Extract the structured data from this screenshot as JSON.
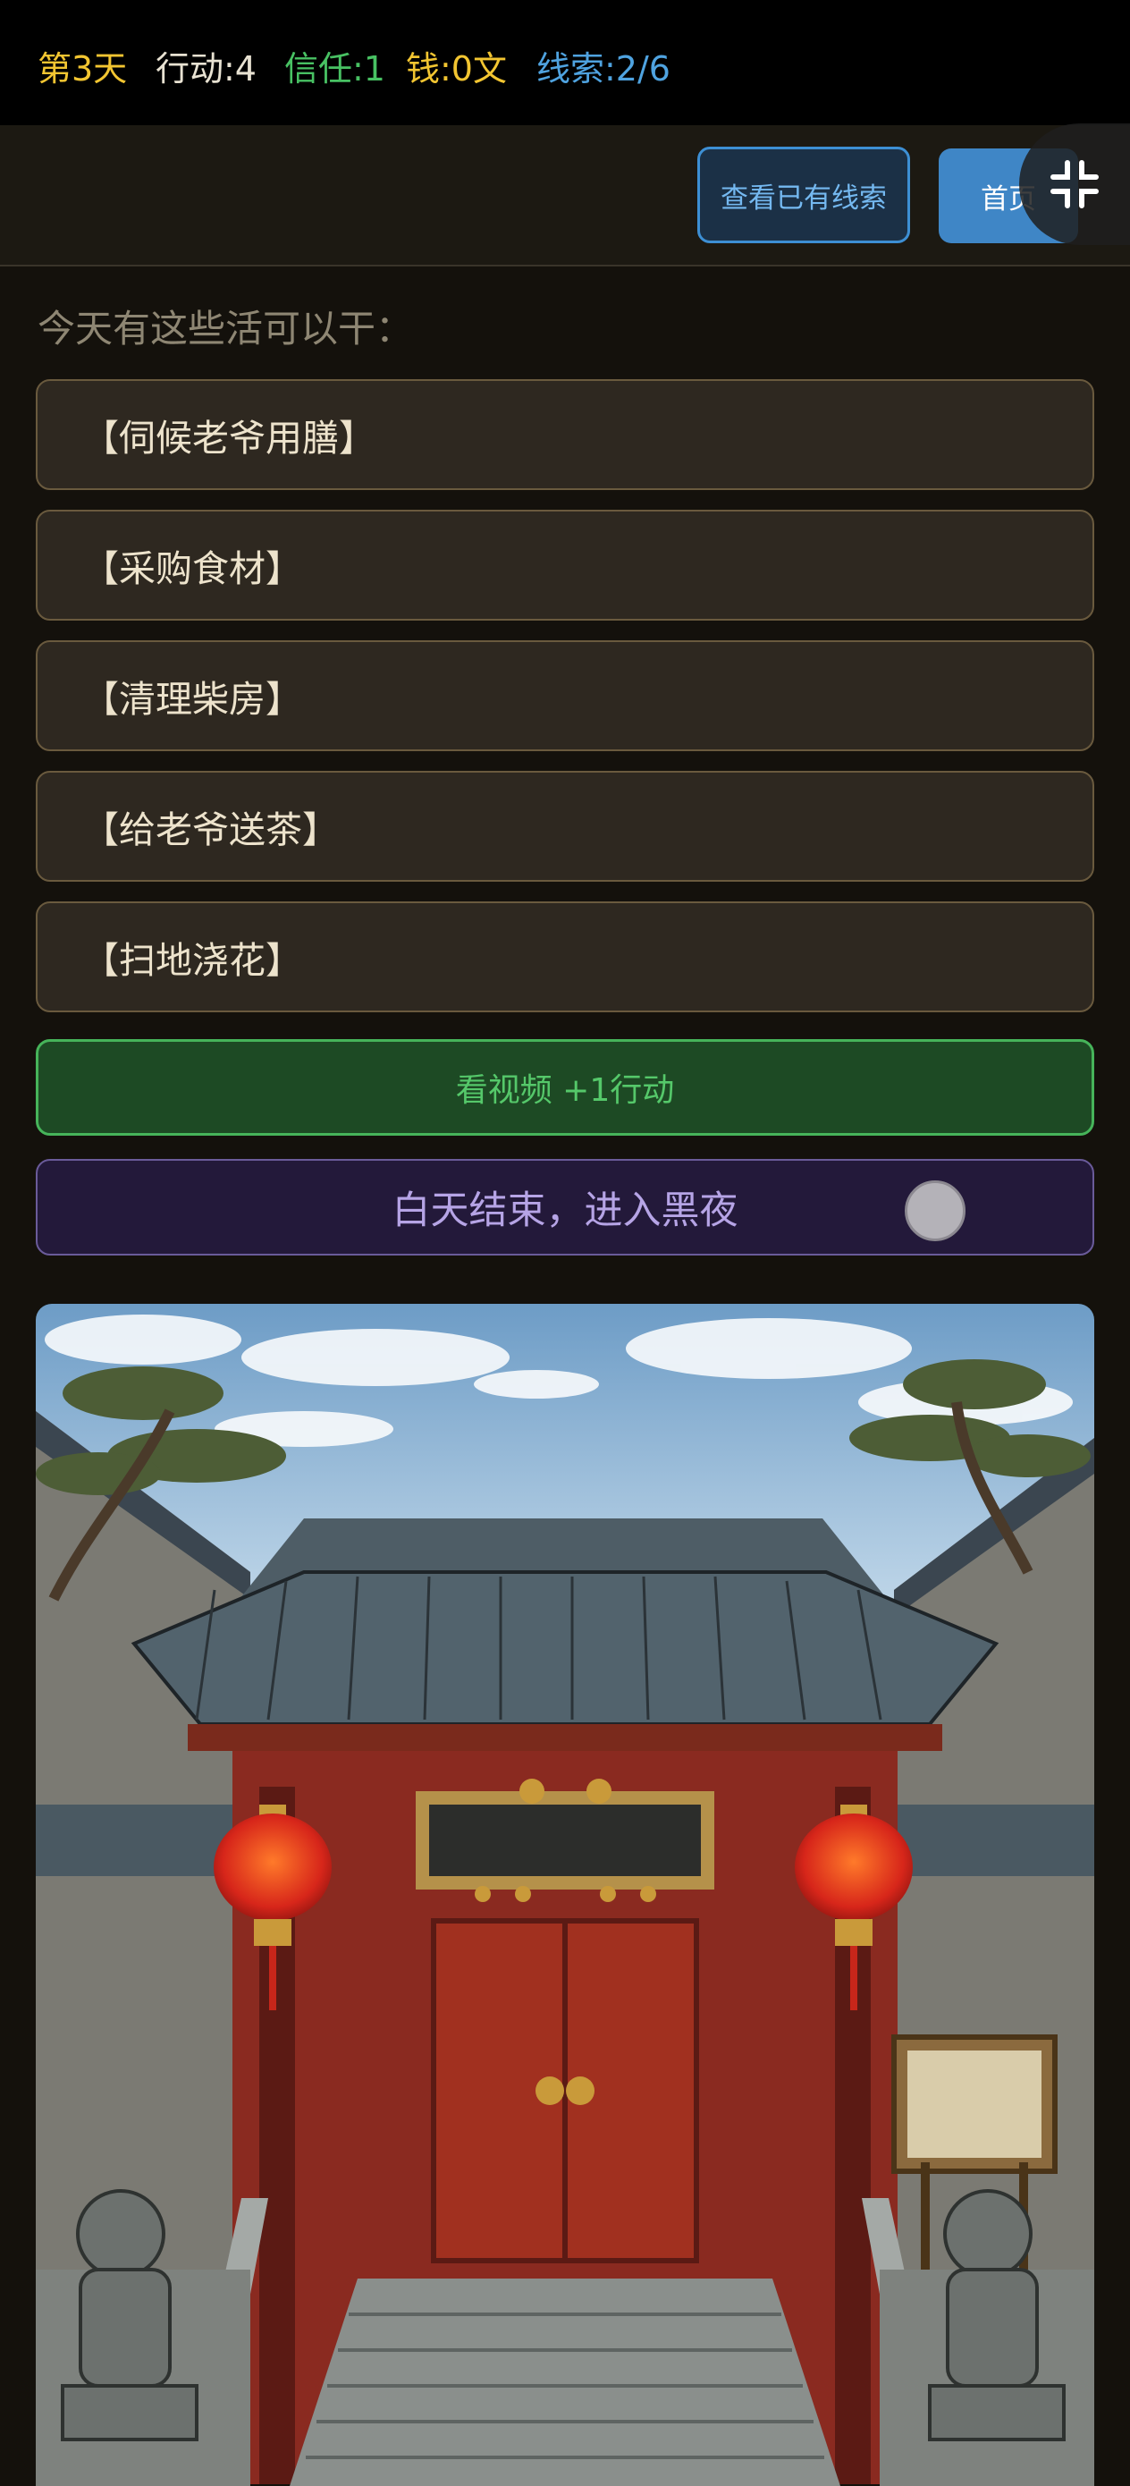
{
  "status": {
    "day": "第3天",
    "actions": "行动:4",
    "trust": "信任:1",
    "money": "钱:0文",
    "clues": "线索:2/6"
  },
  "buttons": {
    "view_clues": "查看已有线索",
    "home": "首页"
  },
  "tasks_prompt": "今天有这些活可以干：",
  "tasks": [
    "【伺候老爷用膳】",
    "【采购食材】",
    "【清理柴房】",
    "【给老爷送茶】",
    "【扫地浇花】"
  ],
  "watch_video": "看视频 +1行动",
  "end_day": "白天结束，进入黑夜",
  "colors": {
    "day": "#f2c531",
    "trust": "#48c163",
    "clues": "#4fa3e0",
    "video": "#55c86a",
    "night": "#b6a4e6"
  },
  "icons": {
    "fullscreen_exit": "fullscreen-exit-icon"
  },
  "scene": "courtyard-gate-illustration"
}
